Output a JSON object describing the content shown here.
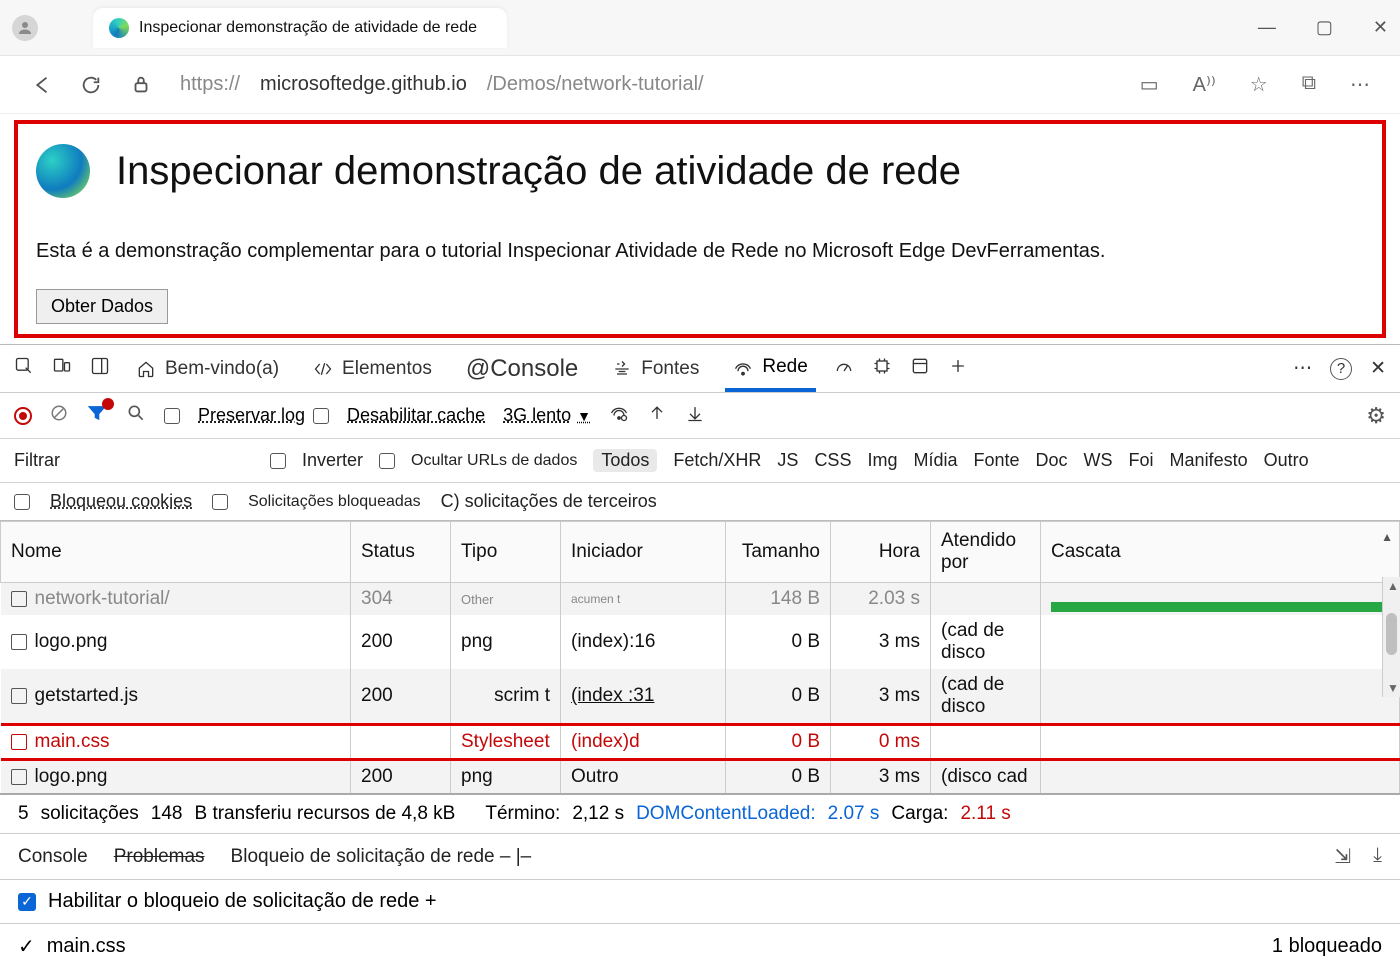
{
  "browser": {
    "tab_title": "Inspecionar demonstração de atividade de rede",
    "url_prefix": "https://",
    "url_host": "microsoftedge.github.io",
    "url_path": "/Demos/network-tutorial/"
  },
  "page": {
    "title": "Inspecionar demonstração de atividade de rede",
    "description": "Esta é a demonstração complementar para o tutorial Inspecionar Atividade de Rede no Microsoft Edge DevFerramentas.",
    "button": "Obter Dados"
  },
  "devtools": {
    "tabs": {
      "welcome": "Bem-vindo(a)",
      "elements": "Elementos",
      "console": "@Console",
      "sources": "Fontes",
      "network": "Rede"
    },
    "net_toolbar": {
      "preserve_log": "Preservar log",
      "disable_cache": "Desabilitar cache",
      "throttle": "3G lento"
    },
    "filters": {
      "filtrar": "Filtrar",
      "inverter": "Inverter",
      "ocultar_urls": "Ocultar URLs de dados",
      "todos": "Todos",
      "fetch_xhr": "Fetch/XHR",
      "js": "JS",
      "css": "CSS",
      "img": "Img",
      "midia": "Mídia",
      "fonte": "Fonte",
      "doc": "Doc",
      "ws": "WS",
      "foi": "Foi",
      "manifesto": "Manifesto",
      "outro": "Outro",
      "bloqueou_cookies": "Bloqueou cookies",
      "solicitacoes_bloqueadas": "Solicitações bloqueadas",
      "terceiros": "C) solicitações de terceiros"
    },
    "columns": {
      "nome": "Nome",
      "status": "Status",
      "tipo": "Tipo",
      "iniciador": "Iniciador",
      "tamanho": "Tamanho",
      "hora": "Hora",
      "atendido_por": "Atendido por",
      "cascata": "Cascata"
    },
    "rows": [
      {
        "nome": "network-tutorial/",
        "status": "304",
        "tipo": "Other",
        "iniciador": "acumen      t",
        "tamanho": "148 B",
        "hora": "2.03 s",
        "atendido": ""
      },
      {
        "nome": "logo.png",
        "status": "200",
        "tipo": "png",
        "iniciador": "(index):16",
        "tamanho": "0 B",
        "hora": "3 ms",
        "atendido": "(cad de disco"
      },
      {
        "nome": "getstarted.js",
        "status": "200",
        "tipo": "scrim t",
        "iniciador": "(index :31",
        "tamanho": "0 B",
        "hora": "3 ms",
        "atendido": "(cad de disco"
      },
      {
        "nome": "main.css",
        "status": "",
        "tipo": "Stylesheet",
        "iniciador": "(index)d",
        "tamanho": "0 B",
        "hora": "0 ms",
        "atendido": ""
      },
      {
        "nome": "logo.png",
        "status": "200",
        "tipo": "png",
        "iniciador": "Outro",
        "tamanho": "0 B",
        "hora": "3 ms",
        "atendido": "(disco cad"
      }
    ],
    "summary": {
      "requests_count": "5",
      "requests_label": "solicitações",
      "transferred": "148",
      "transferred_label": "B transferiu recursos de 4,8 kB",
      "finish_label": "Término:",
      "finish_value": "2,12 s",
      "dom_label": "DOMContentLoaded:",
      "dom_value": "2.07 s",
      "load_label": "Carga:",
      "load_value": "2.11 s"
    },
    "drawer": {
      "console": "Console",
      "problemas": "Problemas",
      "bloqueio": "Bloqueio de solicitação de rede – |–",
      "enable_label": "Habilitar o bloqueio de solicitação de rede +",
      "blocked_item": "main.css",
      "blocked_count": "1 bloqueado"
    }
  }
}
